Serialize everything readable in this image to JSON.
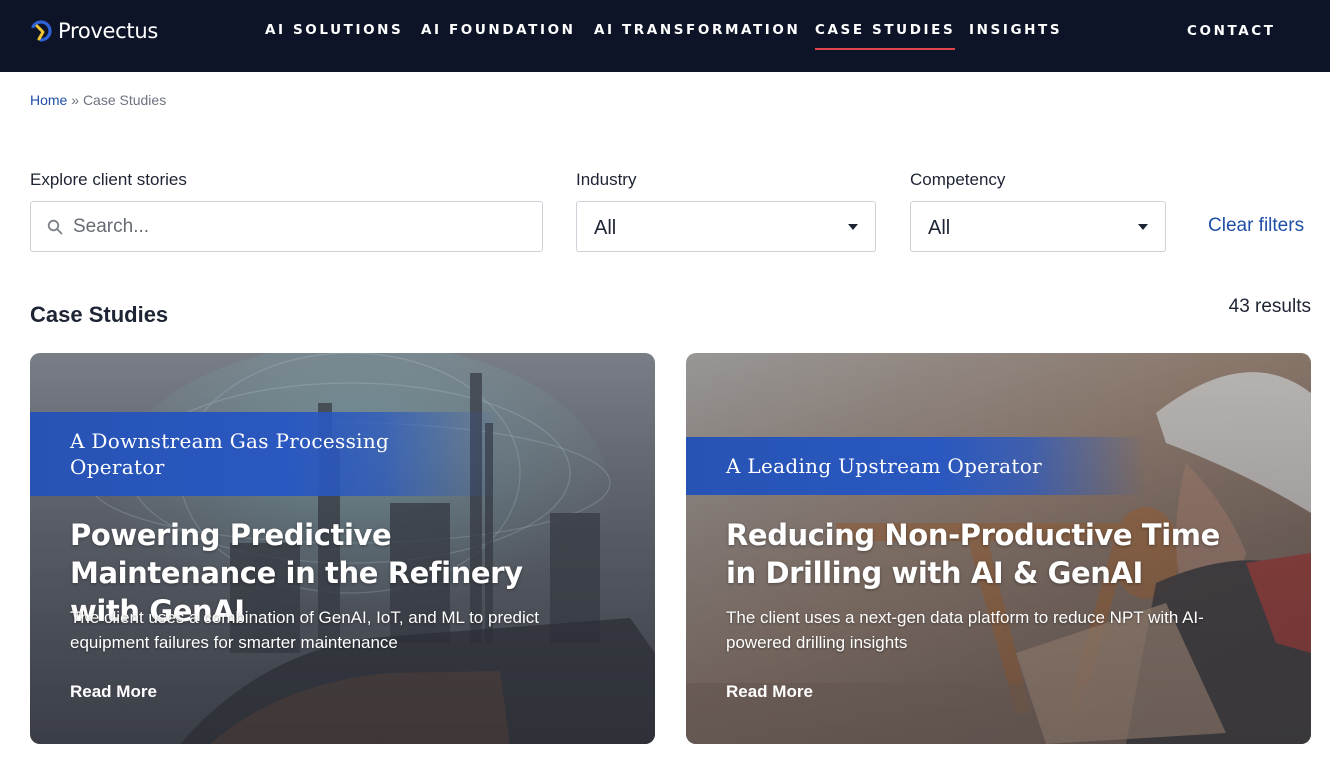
{
  "brand": {
    "name": "Provectus",
    "colors": {
      "nav_bg": "#0d1428",
      "accent": "#e0454e",
      "link": "#1f4fa8",
      "tag_blue": "#2753b5"
    }
  },
  "nav": {
    "items": [
      {
        "label": "AI SOLUTIONS"
      },
      {
        "label": "AI FOUNDATION"
      },
      {
        "label": "AI TRANSFORMATION"
      },
      {
        "label": "CASE STUDIES",
        "active": true
      },
      {
        "label": "INSIGHTS"
      }
    ],
    "contact": "CONTACT"
  },
  "breadcrumb": {
    "home": "Home",
    "separator": "»",
    "current": "Case Studies"
  },
  "filters": {
    "search_label": "Explore client stories",
    "search_placeholder": "Search...",
    "search_value": "",
    "industry_label": "Industry",
    "industry_value": "All",
    "competency_label": "Competency",
    "competency_value": "All",
    "clear": "Clear filters"
  },
  "listing": {
    "title": "Case Studies",
    "results": "43 results"
  },
  "cards": [
    {
      "tag": "A Downstream Gas Processing Operator",
      "tag_lines": [
        "A Downstream Gas Processing",
        "Operator"
      ],
      "title": "Powering Predictive Maintenance in the Refinery with GenAI",
      "description": "The client uses a combination of GenAI, IoT, and ML to predict equipment failures for smarter maintenance",
      "cta": "Read More"
    },
    {
      "tag": "A Leading Upstream Operator",
      "title": "Reducing Non-Productive Time in Drilling with AI & GenAI",
      "description": "The client uses a next-gen data platform to reduce NPT with AI-powered drilling insights",
      "cta": "Read More"
    }
  ],
  "icons": {
    "search": "search-icon",
    "dropdown": "chevron-down-icon"
  }
}
